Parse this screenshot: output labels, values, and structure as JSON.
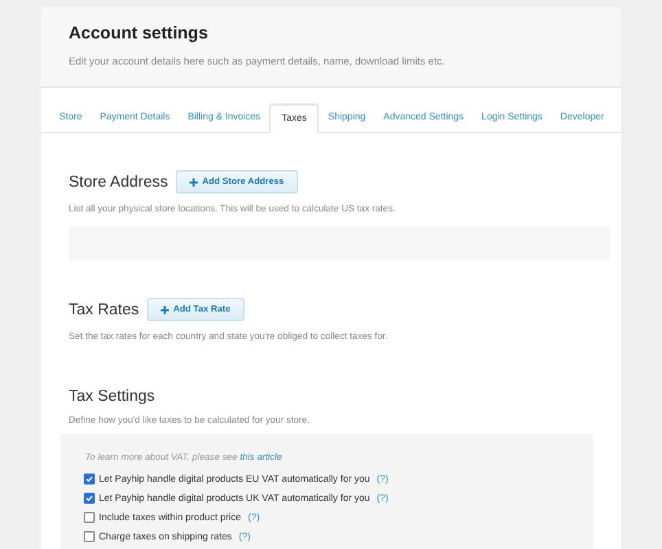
{
  "header": {
    "title": "Account settings",
    "subtitle": "Edit your account details here such as payment details, name, download limits etc."
  },
  "tabs": [
    {
      "label": "Store",
      "selected": false
    },
    {
      "label": "Payment Details",
      "selected": false
    },
    {
      "label": "Billing & Invoices",
      "selected": false
    },
    {
      "label": "Taxes",
      "selected": true
    },
    {
      "label": "Shipping",
      "selected": false
    },
    {
      "label": "Advanced Settings",
      "selected": false
    },
    {
      "label": "Login Settings",
      "selected": false
    },
    {
      "label": "Developer",
      "selected": false
    }
  ],
  "store_address": {
    "title": "Store Address",
    "button": "Add Store Address",
    "description": "List all your physical store locations. This will be used to calculate US tax rates."
  },
  "tax_rates": {
    "title": "Tax Rates",
    "button": "Add Tax Rate",
    "description": "Set the tax rates for each country and state you're obliged to collect taxes for."
  },
  "tax_settings": {
    "title": "Tax Settings",
    "description": "Define how you'd like taxes to be calculated for your store.",
    "intro": "To learn more about VAT, please see",
    "intro_link": "this article",
    "options": [
      {
        "label": "Let Payhip handle digital products EU VAT automatically for you",
        "help": "(?)",
        "checked": true
      },
      {
        "label": "Let Payhip handle digital products UK VAT automatically for you",
        "help": "(?)",
        "checked": true
      },
      {
        "label": "Include taxes within product price",
        "help": "(?)",
        "checked": false
      },
      {
        "label": "Charge taxes on shipping rates",
        "help": "(?)",
        "checked": false
      }
    ]
  }
}
